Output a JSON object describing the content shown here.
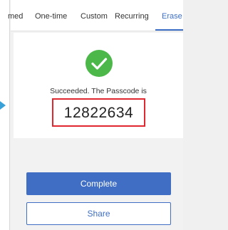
{
  "tabs": [
    {
      "label": "med"
    },
    {
      "label": "One-time"
    },
    {
      "label": "Custom"
    },
    {
      "label": "Recurring"
    },
    {
      "label": "Erase",
      "active": true
    }
  ],
  "result": {
    "status_text": "Succeeded. The Passcode is",
    "passcode": "12822634"
  },
  "actions": {
    "complete_label": "Complete",
    "share_label": "Share"
  },
  "colors": {
    "accent": "#3f6ec4",
    "success": "#4db84a",
    "highlight_border": "#e0262f"
  },
  "icons": {
    "status": "checkmark-circle-icon",
    "pointer": "arrow-right-icon"
  }
}
